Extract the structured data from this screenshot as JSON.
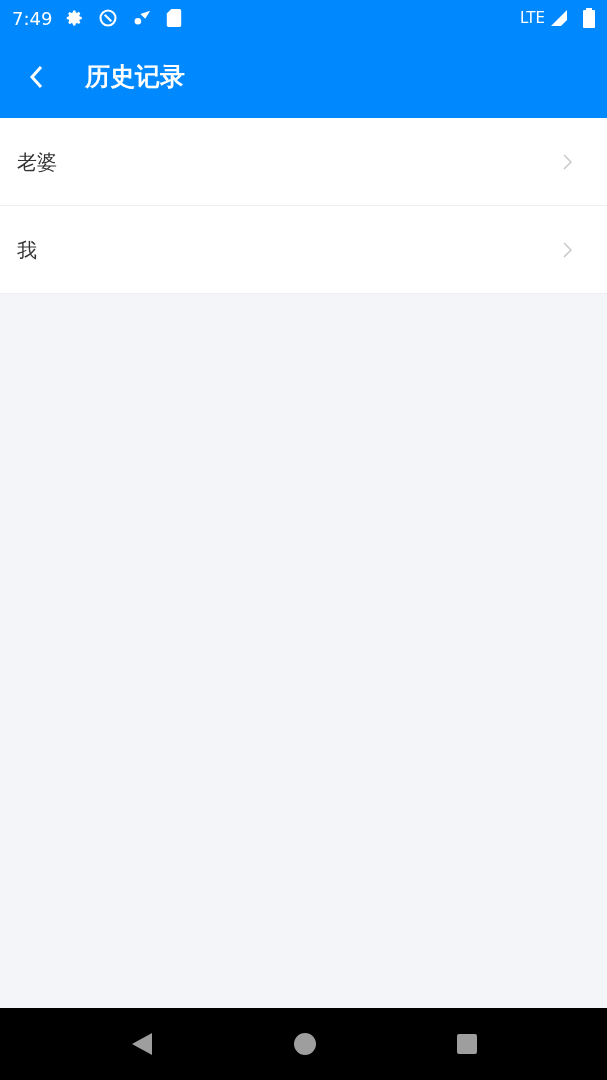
{
  "status_bar": {
    "time": "7:49",
    "network": "LTE"
  },
  "app_bar": {
    "title": "历史记录"
  },
  "list": [
    {
      "label": "老婆"
    },
    {
      "label": "我"
    }
  ]
}
